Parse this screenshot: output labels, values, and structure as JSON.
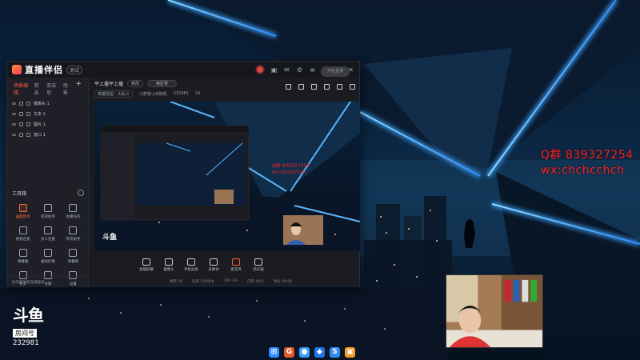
{
  "overlay": {
    "qq_line": "Q群 839327254",
    "wx_line": "wx:chchcchch"
  },
  "douyu_watermark": {
    "logo_text": "斗鱼",
    "room_label": "房间号",
    "room_number": "232981"
  },
  "app": {
    "title": "直播伴侣",
    "version_badge": "测试",
    "scene_tabs": [
      "场景编辑",
      "双击",
      "双击后",
      "场景"
    ],
    "scene_tab_add": "+",
    "sources": [
      "摄像头 1",
      "文本 1",
      "图片 1",
      "窗口 1"
    ],
    "toolbox_title": "工具箱",
    "tools": [
      {
        "label": "画面助手",
        "hot": true
      },
      {
        "label": "房管助手",
        "hot": false
      },
      {
        "label": "主播任务",
        "hot": false
      },
      {
        "label": "视频连麦",
        "hot": false
      },
      {
        "label": "多人连麦",
        "hot": false
      },
      {
        "label": "带货助手",
        "hot": false
      },
      {
        "label": "弹幕播",
        "hot": false
      },
      {
        "label": "虚拟形象",
        "hot": false
      },
      {
        "label": "弹幕库",
        "hot": false
      },
      {
        "label": "更多",
        "hot": false
      },
      {
        "label": "贡献",
        "hot": false
      },
      {
        "label": "设置",
        "hot": false
      }
    ],
    "left_status": "如何把你和直播截屏",
    "stream_title": "平上播平上播",
    "stream_edit": "修改",
    "stream_tag": "绝区零",
    "category_box": "英雄联盟 · 大乱斗",
    "room_box": "小梦想小米随机",
    "room_id": "232981",
    "likes": "16",
    "bottom_buttons": [
      {
        "label": "直播屏幕",
        "hot": false
      },
      {
        "label": "摄像头",
        "hot": false
      },
      {
        "label": "手机投屏",
        "hot": false
      },
      {
        "label": "多媒体",
        "hot": false
      },
      {
        "label": "麦克风",
        "hot": true
      },
      {
        "label": "扬声器",
        "hot": false
      }
    ],
    "go_live_label": "开始直播",
    "status_items": [
      "帧率 30",
      "码率 2500kb",
      "CPU 3%",
      "内存 45%",
      "时长 00:00"
    ]
  },
  "preview_inset": {
    "line1": "Q群 839327254",
    "line2": "wx:chchcchch"
  },
  "taskbar": [
    {
      "name": "windows-start-icon",
      "color": "#2f8cff",
      "glyph": "⊞"
    },
    {
      "name": "g-app-icon",
      "color": "#e05a2a",
      "glyph": "G"
    },
    {
      "name": "browser-icon",
      "color": "#3aa0ff",
      "glyph": "●"
    },
    {
      "name": "douyu-icon",
      "color": "#2575e6",
      "glyph": "◆"
    },
    {
      "name": "s-app-icon",
      "color": "#2e8bf2",
      "glyph": "S"
    },
    {
      "name": "orange-app-icon",
      "color": "#f59b23",
      "glyph": "▣"
    }
  ]
}
